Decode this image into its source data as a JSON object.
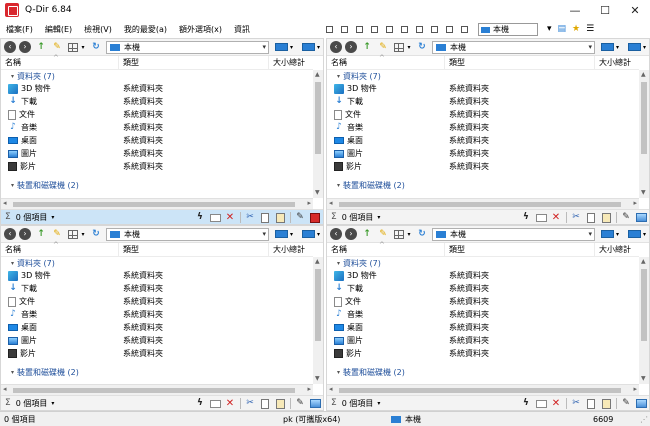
{
  "window": {
    "title": "Q-Dir 6.84",
    "minimize": "—",
    "maximize": "☐",
    "close": "✕"
  },
  "menu": [
    "檔案(F)",
    "編輯(E)",
    "檢視(V)",
    "我的最愛(a)",
    "額外選項(x)",
    "資訊"
  ],
  "menu_toolbar": {
    "combo": "本機"
  },
  "columns": {
    "name": "名稱",
    "type": "類型",
    "size": "大小總計"
  },
  "panes": [
    {
      "address": "本機",
      "active": true,
      "group_folders": "資料夾 (7)",
      "group_devices": "裝置和磁碟機 (2)",
      "count": "0 個項目",
      "items": [
        {
          "name": "3D 物件",
          "type": "系統資料夾",
          "icon": "cube-icon"
        },
        {
          "name": "下載",
          "type": "系統資料夾",
          "icon": "download-arrow-icon"
        },
        {
          "name": "文件",
          "type": "系統資料夾",
          "icon": "document-icon"
        },
        {
          "name": "音樂",
          "type": "系統資料夾",
          "icon": "music-note-icon"
        },
        {
          "name": "桌面",
          "type": "系統資料夾",
          "icon": "desktop-icon"
        },
        {
          "name": "圖片",
          "type": "系統資料夾",
          "icon": "pictures-icon"
        },
        {
          "name": "影片",
          "type": "系統資料夾",
          "icon": "video-icon"
        }
      ]
    },
    {
      "address": "本機",
      "active": false,
      "group_folders": "資料夾 (7)",
      "group_devices": "裝置和磁碟機 (2)",
      "count": "0 個項目",
      "items": [
        {
          "name": "3D 物件",
          "type": "系統資料夾",
          "icon": "cube-icon"
        },
        {
          "name": "下載",
          "type": "系統資料夾",
          "icon": "download-arrow-icon"
        },
        {
          "name": "文件",
          "type": "系統資料夾",
          "icon": "document-icon"
        },
        {
          "name": "音樂",
          "type": "系統資料夾",
          "icon": "music-note-icon"
        },
        {
          "name": "桌面",
          "type": "系統資料夾",
          "icon": "desktop-icon"
        },
        {
          "name": "圖片",
          "type": "系統資料夾",
          "icon": "pictures-icon"
        },
        {
          "name": "影片",
          "type": "系統資料夾",
          "icon": "video-icon"
        }
      ]
    },
    {
      "address": "本機",
      "active": false,
      "group_folders": "資料夾 (7)",
      "group_devices": "裝置和磁碟機 (2)",
      "count": "0 個項目",
      "items": [
        {
          "name": "3D 物件",
          "type": "系統資料夾",
          "icon": "cube-icon"
        },
        {
          "name": "下載",
          "type": "系統資料夾",
          "icon": "download-arrow-icon"
        },
        {
          "name": "文件",
          "type": "系統資料夾",
          "icon": "document-icon"
        },
        {
          "name": "音樂",
          "type": "系統資料夾",
          "icon": "music-note-icon"
        },
        {
          "name": "桌面",
          "type": "系統資料夾",
          "icon": "desktop-icon"
        },
        {
          "name": "圖片",
          "type": "系統資料夾",
          "icon": "pictures-icon"
        },
        {
          "name": "影片",
          "type": "系統資料夾",
          "icon": "video-icon"
        }
      ]
    },
    {
      "address": "本機",
      "active": false,
      "group_folders": "資料夾 (7)",
      "group_devices": "裝置和磁碟機 (2)",
      "count": "0 個項目",
      "items": [
        {
          "name": "3D 物件",
          "type": "系統資料夾",
          "icon": "cube-icon"
        },
        {
          "name": "下載",
          "type": "系統資料夾",
          "icon": "download-arrow-icon"
        },
        {
          "name": "文件",
          "type": "系統資料夾",
          "icon": "document-icon"
        },
        {
          "name": "音樂",
          "type": "系統資料夾",
          "icon": "music-note-icon"
        },
        {
          "name": "桌面",
          "type": "系統資料夾",
          "icon": "desktop-icon"
        },
        {
          "name": "圖片",
          "type": "系統資料夾",
          "icon": "pictures-icon"
        },
        {
          "name": "影片",
          "type": "系統資料夾",
          "icon": "video-icon"
        }
      ]
    }
  ],
  "status_bar": {
    "left": "0 個項目",
    "middle": "pk (可攜版x64)",
    "location": "本機",
    "right": "6609"
  },
  "colors": {
    "accent": "#2a7fd4",
    "group_header": "#1e4e9a",
    "active_status": "#cce4f7",
    "delete": "#d02020",
    "app_icon": "#d9272e"
  }
}
